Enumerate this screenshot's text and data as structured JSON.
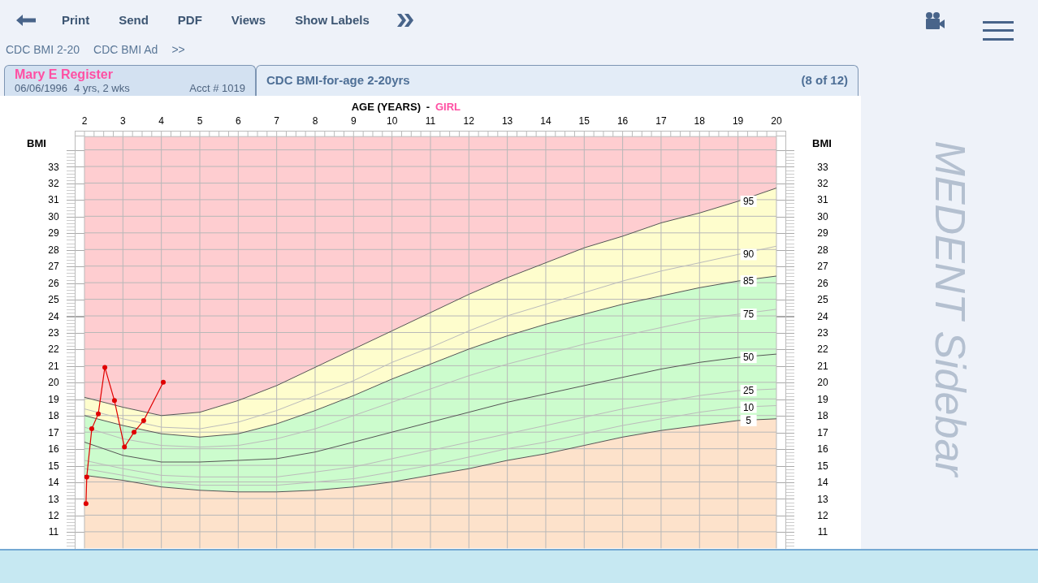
{
  "toolbar": {
    "items": [
      {
        "kind": "back"
      },
      {
        "kind": "text",
        "label": "Print"
      },
      {
        "kind": "text",
        "label": "Send"
      },
      {
        "kind": "text",
        "label": "PDF"
      },
      {
        "kind": "text",
        "label": "Views"
      },
      {
        "kind": "text",
        "label": "Show Labels"
      },
      {
        "kind": "more"
      }
    ]
  },
  "subnav": {
    "items": [
      "CDC BMI 2-20",
      "CDC BMI Ad",
      ">>"
    ]
  },
  "patient_tab": {
    "name": "Mary E Register",
    "dob": "06/06/1996",
    "age": "4 yrs, 2 wks",
    "account": "Acct # 1019"
  },
  "chart_tab": {
    "title": "CDC BMI-for-age 2-20yrs",
    "position": "(8 of 12)"
  },
  "chart": {
    "separator": "-",
    "sex": "GIRL",
    "right_label": "BMI",
    "right_yticks": [
      "33",
      "32",
      "31",
      "30",
      "29",
      "28",
      "27",
      "26",
      "25",
      "24",
      "23",
      "22",
      "21",
      "20",
      "19",
      "18",
      "17",
      "16",
      "15",
      "14",
      "13",
      "12",
      "11"
    ],
    "chart_data": {
      "type": "line",
      "xlabel": "AGE (YEARS)",
      "ylabel": "BMI",
      "grid": true,
      "x": [
        2,
        3,
        4,
        5,
        6,
        7,
        8,
        9,
        10,
        11,
        12,
        13,
        14,
        15,
        16,
        17,
        18,
        19,
        20
      ],
      "xlim": [
        2,
        20
      ],
      "ylim": [
        10,
        34.8
      ],
      "xticks": [
        2,
        3,
        4,
        5,
        6,
        7,
        8,
        9,
        10,
        11,
        12,
        13,
        14,
        15,
        16,
        17,
        18,
        19,
        20
      ],
      "yticks": [
        11,
        12,
        13,
        14,
        15,
        16,
        17,
        18,
        19,
        20,
        21,
        22,
        23,
        24,
        25,
        26,
        27,
        28,
        29,
        30,
        31,
        32,
        33
      ],
      "series": [
        {
          "name": "95",
          "color": "#555555",
          "values": [
            19.1,
            18.5,
            18.0,
            18.2,
            18.9,
            19.8,
            20.9,
            22.0,
            23.1,
            24.2,
            25.3,
            26.3,
            27.2,
            28.1,
            28.8,
            29.6,
            30.2,
            30.9,
            31.7
          ]
        },
        {
          "name": "90",
          "color": "#bbbbbb",
          "values": [
            18.4,
            17.8,
            17.3,
            17.2,
            17.6,
            18.3,
            19.2,
            20.1,
            21.2,
            22.1,
            23.1,
            24.0,
            24.7,
            25.4,
            26.1,
            26.7,
            27.2,
            27.7,
            28.2
          ]
        },
        {
          "name": "85",
          "color": "#555555",
          "values": [
            18.0,
            17.4,
            16.9,
            16.7,
            16.9,
            17.5,
            18.3,
            19.2,
            20.2,
            21.1,
            22.0,
            22.8,
            23.5,
            24.1,
            24.7,
            25.2,
            25.7,
            26.1,
            26.4
          ]
        },
        {
          "name": "75",
          "color": "#bbbbbb",
          "values": [
            17.3,
            16.6,
            16.2,
            16.1,
            16.2,
            16.6,
            17.2,
            18.0,
            18.8,
            19.6,
            20.4,
            21.1,
            21.7,
            22.3,
            22.8,
            23.3,
            23.8,
            24.1,
            24.4
          ]
        },
        {
          "name": "50",
          "color": "#555555",
          "values": [
            16.4,
            15.6,
            15.2,
            15.2,
            15.3,
            15.4,
            15.8,
            16.4,
            17.0,
            17.6,
            18.2,
            18.8,
            19.3,
            19.8,
            20.3,
            20.8,
            21.2,
            21.5,
            21.7
          ]
        },
        {
          "name": "25",
          "color": "#bbbbbb",
          "values": [
            15.3,
            14.8,
            14.4,
            14.3,
            14.3,
            14.3,
            14.6,
            14.9,
            15.4,
            15.9,
            16.4,
            16.9,
            17.4,
            17.9,
            18.4,
            18.8,
            19.2,
            19.5,
            19.6
          ]
        },
        {
          "name": "10",
          "color": "#bbbbbb",
          "values": [
            14.8,
            14.4,
            14.0,
            13.8,
            13.8,
            13.8,
            14.0,
            14.2,
            14.6,
            15.0,
            15.5,
            16.0,
            16.4,
            16.9,
            17.4,
            17.8,
            18.2,
            18.5,
            18.6
          ]
        },
        {
          "name": "5",
          "color": "#555555",
          "values": [
            14.4,
            14.1,
            13.7,
            13.5,
            13.4,
            13.4,
            13.5,
            13.7,
            14.0,
            14.4,
            14.8,
            15.3,
            15.7,
            16.2,
            16.7,
            17.1,
            17.4,
            17.7,
            17.8
          ]
        },
        {
          "marker": "o",
          "color": "#e00000",
          "x": [
            2.04,
            2.06,
            2.19,
            2.36,
            2.53,
            2.78,
            3.04,
            3.29,
            3.54,
            4.05
          ],
          "values": [
            12.7,
            14.3,
            17.2,
            18.1,
            20.9,
            18.9,
            16.1,
            17.0,
            17.7,
            20.0
          ]
        }
      ]
    }
  },
  "sidebar": {
    "title": "MEDENT Sidebar"
  }
}
